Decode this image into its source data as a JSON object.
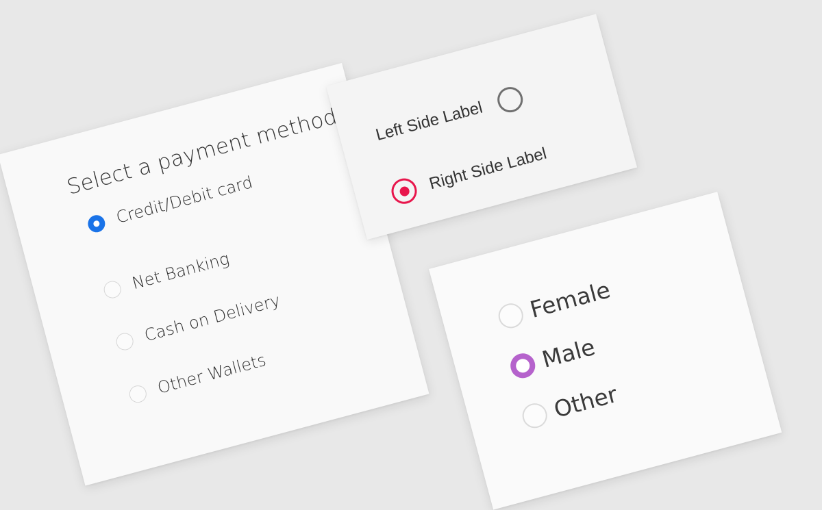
{
  "payment_card": {
    "title": "Select a payment method",
    "options": [
      {
        "label": "Credit/Debit card",
        "selected": true
      },
      {
        "label": "Net Banking",
        "selected": false
      },
      {
        "label": "Cash on Delivery",
        "selected": false
      },
      {
        "label": "Other Wallets",
        "selected": false
      }
    ],
    "accent_color": "#1a73e8"
  },
  "label_position_card": {
    "options": [
      {
        "label": "Left Side Label",
        "selected": false
      },
      {
        "label": "Right Side Label",
        "selected": true
      }
    ],
    "accent_color": "#e8164c"
  },
  "gender_card": {
    "options": [
      {
        "label": "Female",
        "selected": false
      },
      {
        "label": "Male",
        "selected": true
      },
      {
        "label": "Other",
        "selected": false
      }
    ],
    "accent_color": "#b562cc"
  }
}
